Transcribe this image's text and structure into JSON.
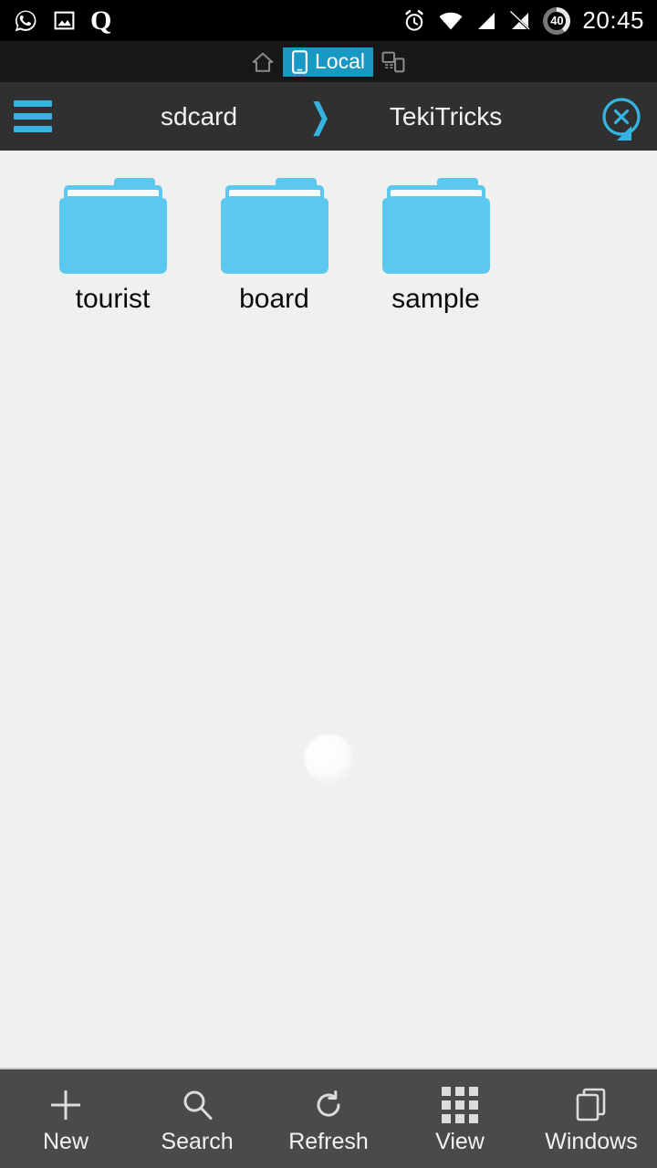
{
  "status_bar": {
    "left_icons": [
      {
        "name": "whatsapp-icon",
        "glyph": "whatsapp"
      },
      {
        "name": "gallery-image-icon",
        "glyph": "image"
      },
      {
        "name": "quora-q-icon",
        "glyph": "Q"
      }
    ],
    "right_icons": [
      {
        "name": "alarm-clock-icon",
        "glyph": "alarm"
      },
      {
        "name": "wifi-icon",
        "glyph": "wifi"
      },
      {
        "name": "signal-bars-icon",
        "glyph": "signal"
      },
      {
        "name": "no-sim-signal-icon",
        "glyph": "signal-off"
      }
    ],
    "battery_level": "40",
    "clock": "20:45"
  },
  "tabs": [
    {
      "label": "",
      "icon": "home-icon",
      "active": false
    },
    {
      "label": "Local",
      "icon": "phone-icon",
      "active": true
    },
    {
      "label": "",
      "icon": "network-devices-icon",
      "active": false
    }
  ],
  "path_bar": {
    "menu_icon": "hamburger-menu-icon",
    "crumbs": [
      "sdcard",
      "TekiTricks"
    ],
    "separator": "❯",
    "close_icon": "close-circle-icon"
  },
  "files": [
    {
      "name": "tourist",
      "type": "folder"
    },
    {
      "name": "board",
      "type": "folder"
    },
    {
      "name": "sample",
      "type": "folder"
    }
  ],
  "toolbar": [
    {
      "label": "New",
      "icon": "plus-icon"
    },
    {
      "label": "Search",
      "icon": "search-icon"
    },
    {
      "label": "Refresh",
      "icon": "refresh-icon"
    },
    {
      "label": "View",
      "icon": "grid-view-icon"
    },
    {
      "label": "Windows",
      "icon": "windows-stack-icon"
    }
  ],
  "colors": {
    "accent_cyan": "#35b4e3",
    "tab_highlight": "#1899c4",
    "folder_blue": "#5bc8f0",
    "background": "#f0f0f0",
    "path_bar": "#303030",
    "toolbar": "#4a4a4a"
  }
}
